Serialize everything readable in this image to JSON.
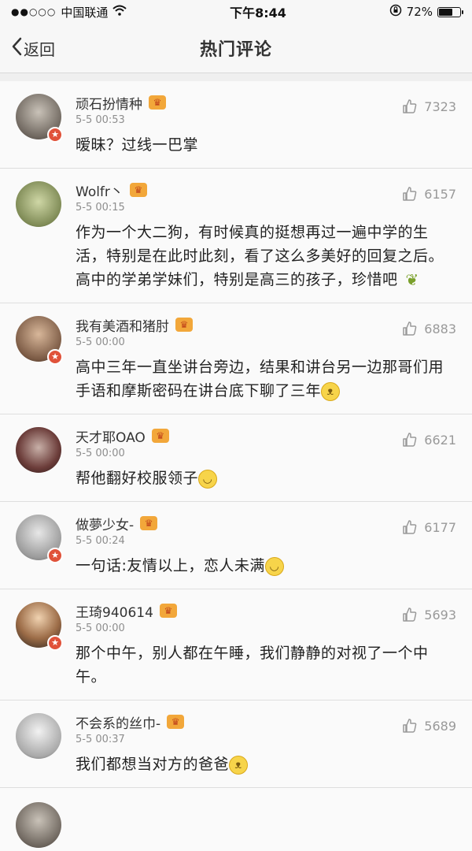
{
  "status": {
    "carrier": "中国联通",
    "time": "下午8:44",
    "battery": "72%",
    "battery_level": 0.72
  },
  "nav": {
    "back_label": "返回",
    "title": "热门评论"
  },
  "comments": [
    {
      "username": "顽石扮情种",
      "time": "5-5 00:53",
      "likes": "7323",
      "text": "暧昧？过线一巴掌",
      "emoji": ""
    },
    {
      "username": "Wolfr丶",
      "time": "5-5 00:15",
      "likes": "6157",
      "text": "作为一个大二狗，有时候真的挺想再过一遍中学的生活，特别是在此时此刻，看了这么多美好的回复之后。高中的学弟学妹们，特别是高三的孩子，珍惜吧",
      "emoji": "leaf"
    },
    {
      "username": "我有美酒和猪肘",
      "time": "5-5 00:00",
      "likes": "6883",
      "text": "高中三年一直坐讲台旁边，结果和讲台另一边那哥们用手语和摩斯密码在讲台底下聊了三年",
      "emoji": "doge"
    },
    {
      "username": "天才耶OAO",
      "time": "5-5 00:00",
      "likes": "6621",
      "text": "帮他翻好校服领子",
      "emoji": "smile"
    },
    {
      "username": "做夢少女-",
      "time": "5-5 00:24",
      "likes": "6177",
      "text": "一句话:友情以上，恋人未满",
      "emoji": "smile"
    },
    {
      "username": "王琦940614",
      "time": "5-5 00:00",
      "likes": "5693",
      "text": "那个中午，别人都在午睡，我们静静的对视了一个中午。",
      "emoji": ""
    },
    {
      "username": "不会系的丝巾-",
      "time": "5-5 00:37",
      "likes": "5689",
      "text": "我们都想当对方的爸爸",
      "emoji": "doge"
    }
  ]
}
